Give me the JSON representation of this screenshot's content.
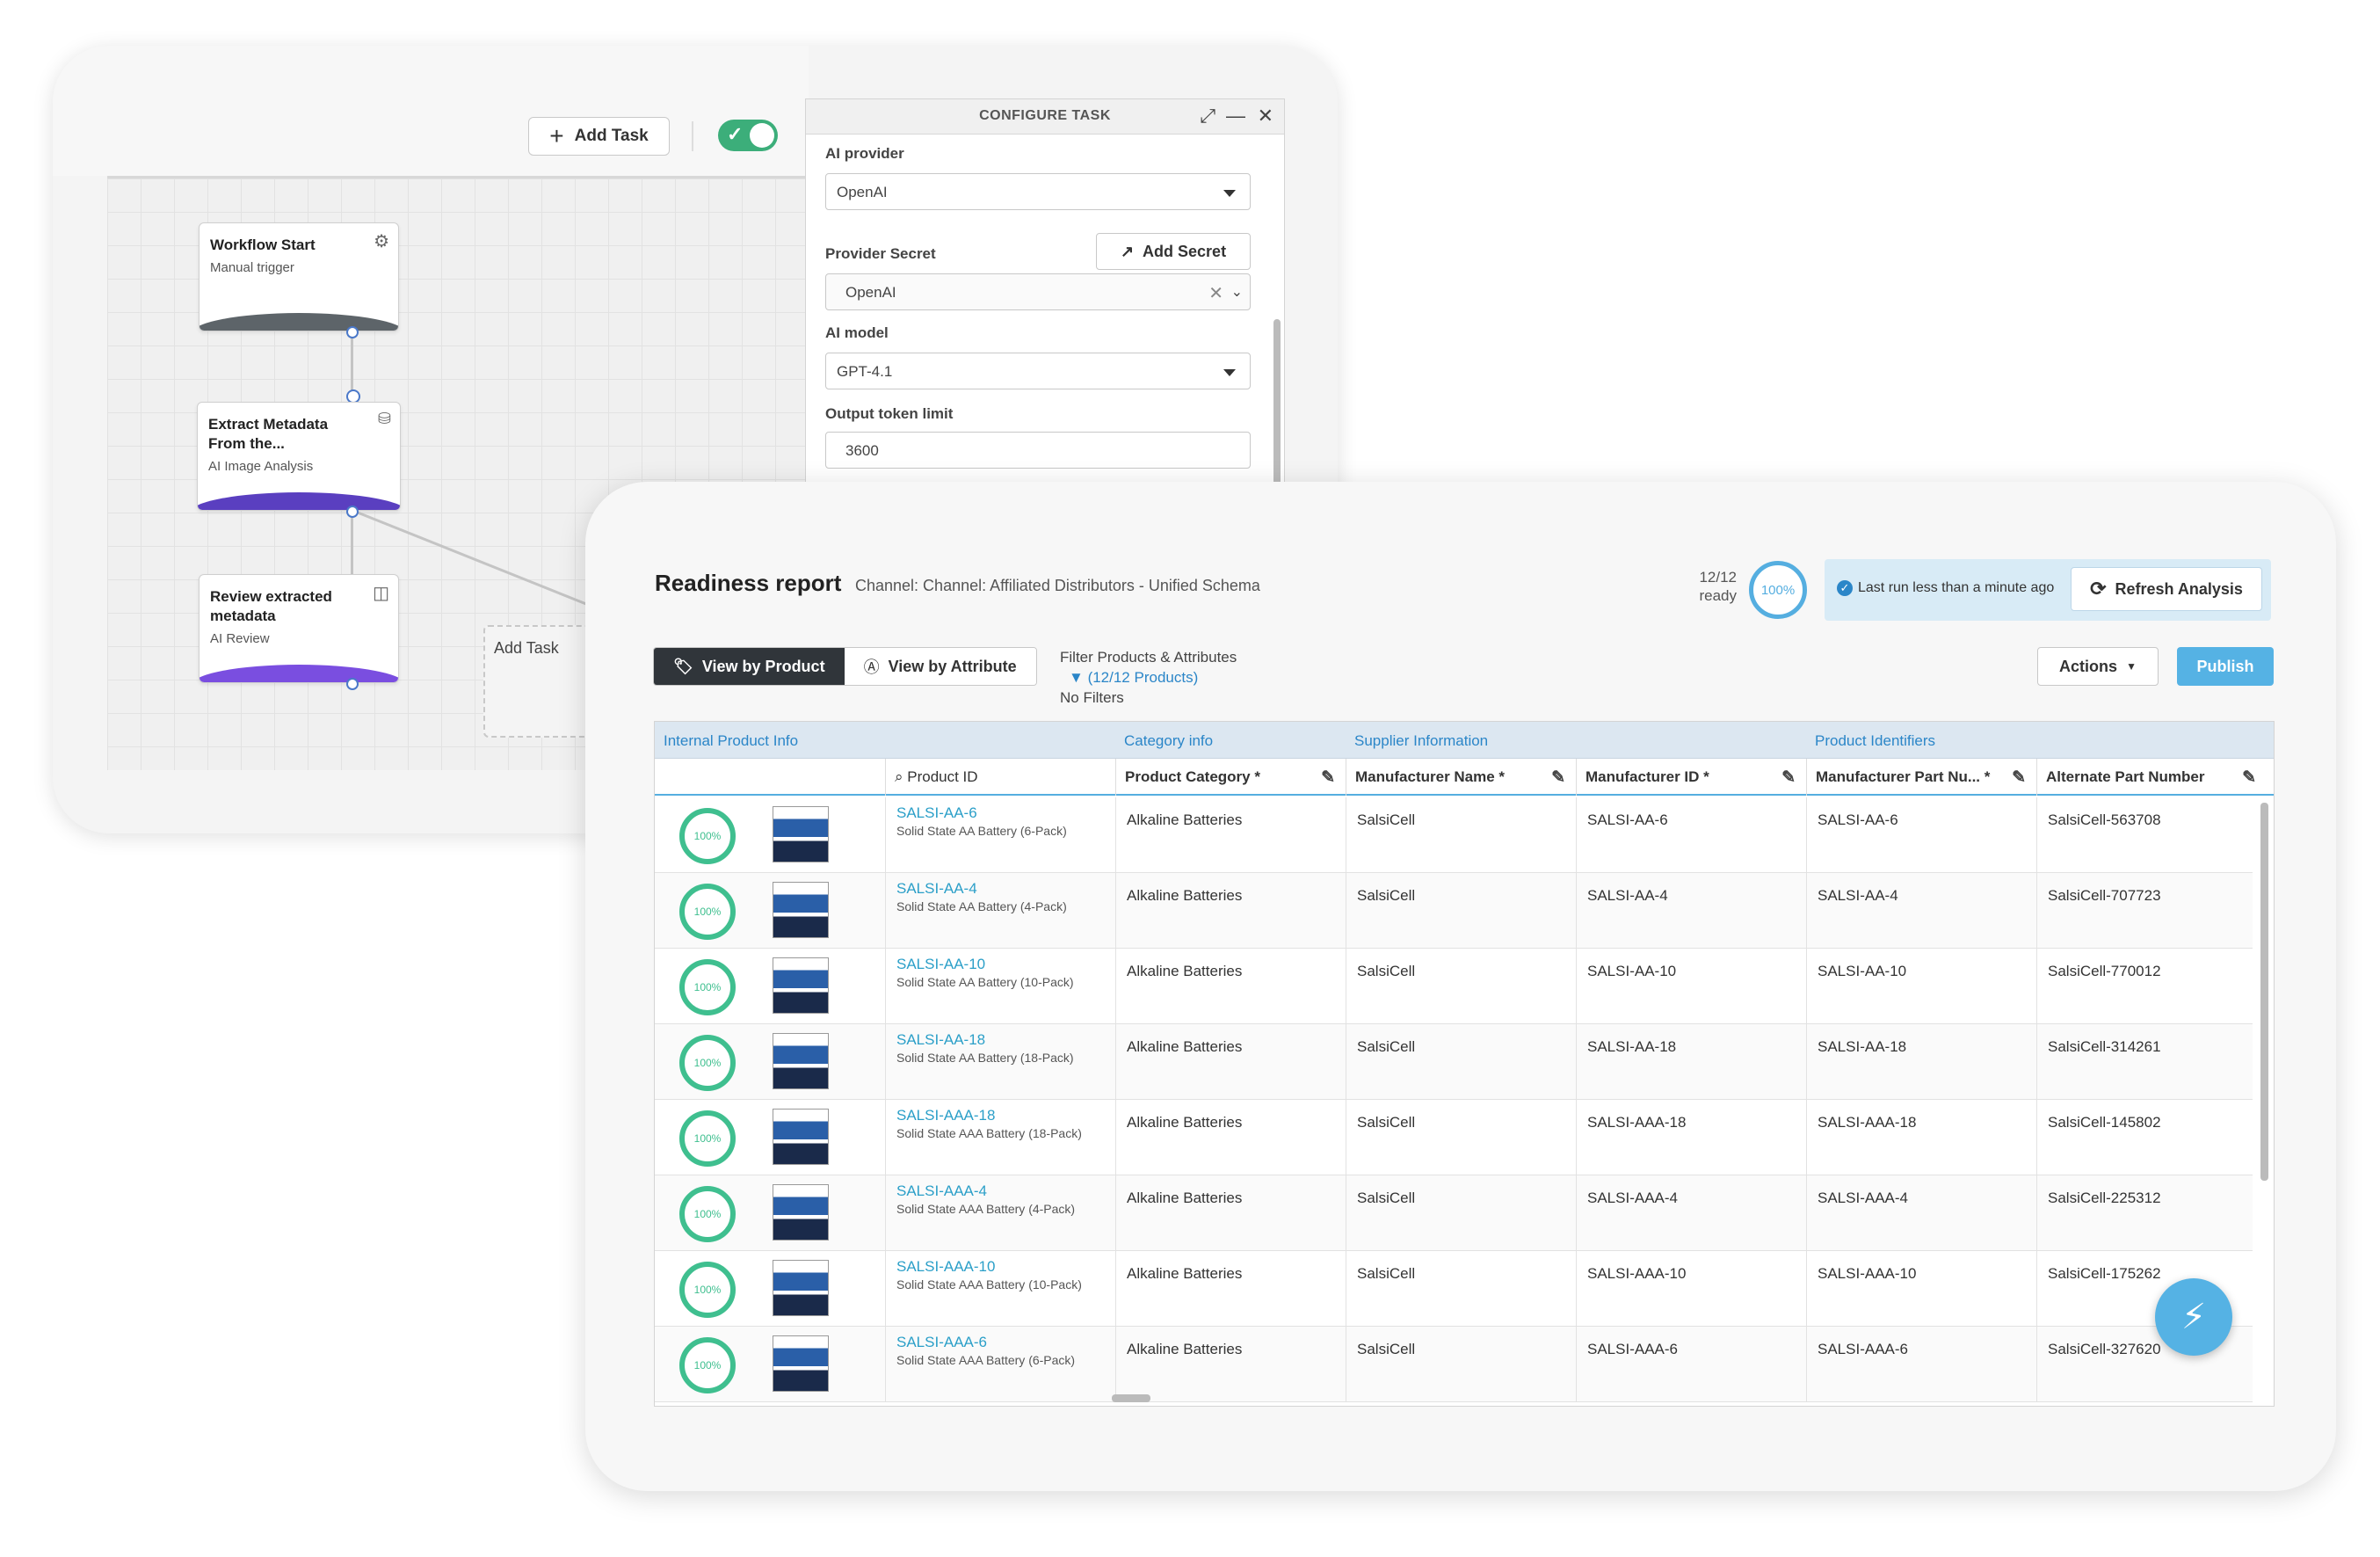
{
  "workflow": {
    "add_task_label": "Add Task",
    "toggle_on": true,
    "nodes": [
      {
        "title": "Workflow Start",
        "subtitle": "Manual trigger",
        "icon": "gear-icon"
      },
      {
        "title": "Extract Metadata From the...",
        "subtitle": "AI Image Analysis",
        "icon": "ai-brain-icon"
      },
      {
        "title": "Review extracted metadata",
        "subtitle": "AI Review",
        "icon": "review-panel-icon"
      }
    ],
    "ghost_label": "Add Task"
  },
  "configure": {
    "title": "CONFIGURE TASK",
    "provider_label": "AI provider",
    "provider_value": "OpenAI",
    "secret_label": "Provider Secret",
    "add_secret_label": "Add Secret",
    "secret_value": "OpenAI",
    "model_label": "AI model",
    "model_value": "GPT-4.1",
    "token_label": "Output token limit",
    "token_value": "3600"
  },
  "report": {
    "title": "Readiness report",
    "channel": "Channel: Channel: Affiliated Distributors - Unified Schema",
    "ready_count": "12/12",
    "ready_word": "ready",
    "ready_percent": "100%",
    "last_run": "Last run less than a minute ago",
    "refresh_label": "Refresh Analysis",
    "view_by_product": "View by Product",
    "view_by_attribute": "View by Attribute",
    "filter_title": "Filter Products & Attributes",
    "filter_link": "(12/12 Products)",
    "filter_none": "No Filters",
    "actions_label": "Actions",
    "publish_label": "Publish",
    "groups": [
      "Internal Product Info",
      "Category info",
      "Supplier Information",
      "Product Identifiers"
    ],
    "columns": [
      "Product ID",
      "Product Category *",
      "Manufacturer Name *",
      "Manufacturer ID *",
      "Manufacturer Part Nu... *",
      "Alternate Part Number"
    ],
    "rows": [
      {
        "pct": "100%",
        "id": "SALSI-AA-6",
        "name": "Solid State AA Battery (6-Pack)",
        "cat": "Alkaline Batteries",
        "mfr": "SalsiCell",
        "mid": "SALSI-AA-6",
        "mpn": "SALSI-AA-6",
        "alt": "SalsiCell-563708"
      },
      {
        "pct": "100%",
        "id": "SALSI-AA-4",
        "name": "Solid State AA Battery (4-Pack)",
        "cat": "Alkaline Batteries",
        "mfr": "SalsiCell",
        "mid": "SALSI-AA-4",
        "mpn": "SALSI-AA-4",
        "alt": "SalsiCell-707723"
      },
      {
        "pct": "100%",
        "id": "SALSI-AA-10",
        "name": "Solid State AA Battery (10-Pack)",
        "cat": "Alkaline Batteries",
        "mfr": "SalsiCell",
        "mid": "SALSI-AA-10",
        "mpn": "SALSI-AA-10",
        "alt": "SalsiCell-770012"
      },
      {
        "pct": "100%",
        "id": "SALSI-AA-18",
        "name": "Solid State AA Battery (18-Pack)",
        "cat": "Alkaline Batteries",
        "mfr": "SalsiCell",
        "mid": "SALSI-AA-18",
        "mpn": "SALSI-AA-18",
        "alt": "SalsiCell-314261"
      },
      {
        "pct": "100%",
        "id": "SALSI-AAA-18",
        "name": "Solid State AAA Battery (18-Pack)",
        "cat": "Alkaline Batteries",
        "mfr": "SalsiCell",
        "mid": "SALSI-AAA-18",
        "mpn": "SALSI-AAA-18",
        "alt": "SalsiCell-145802"
      },
      {
        "pct": "100%",
        "id": "SALSI-AAA-4",
        "name": "Solid State AAA Battery (4-Pack)",
        "cat": "Alkaline Batteries",
        "mfr": "SalsiCell",
        "mid": "SALSI-AAA-4",
        "mpn": "SALSI-AAA-4",
        "alt": "SalsiCell-225312"
      },
      {
        "pct": "100%",
        "id": "SALSI-AAA-10",
        "name": "Solid State AAA Battery (10-Pack)",
        "cat": "Alkaline Batteries",
        "mfr": "SalsiCell",
        "mid": "SALSI-AAA-10",
        "mpn": "SALSI-AAA-10",
        "alt": "SalsiCell-175262"
      },
      {
        "pct": "100%",
        "id": "SALSI-AAA-6",
        "name": "Solid State AAA Battery (6-Pack)",
        "cat": "Alkaline Batteries",
        "mfr": "SalsiCell",
        "mid": "SALSI-AAA-6",
        "mpn": "SALSI-AAA-6",
        "alt": "SalsiCell-327620"
      }
    ]
  },
  "colors": {
    "accent": "#55b2e4",
    "ready_green": "#3fbf8f",
    "toggle_green": "#3cae7a",
    "link": "#2b86c8",
    "purple": "#6c3fd0"
  }
}
